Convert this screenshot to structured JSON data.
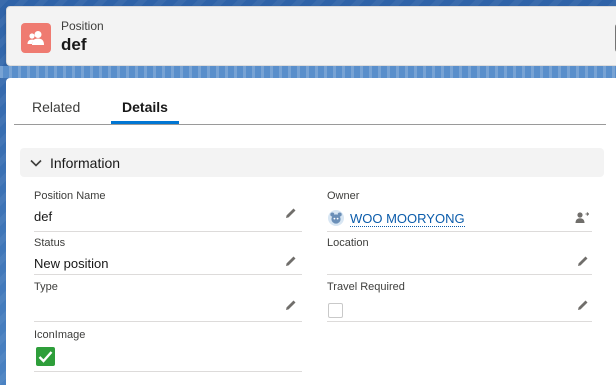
{
  "header": {
    "object_type": "Position",
    "record_name": "def",
    "icon": "position-icon"
  },
  "tabs": [
    {
      "label": "Related",
      "active": false
    },
    {
      "label": "Details",
      "active": true
    }
  ],
  "section": {
    "title": "Information",
    "icon": "chevron-down-icon"
  },
  "fields": {
    "position_name": {
      "label": "Position Name",
      "value": "def",
      "icon": "pencil-icon"
    },
    "owner": {
      "label": "Owner",
      "value": "WOO MOORYONG",
      "icon": "change-owner-icon",
      "avatar": "avatar-icon"
    },
    "status": {
      "label": "Status",
      "value": "New position",
      "icon": "pencil-icon"
    },
    "location": {
      "label": "Location",
      "value": "",
      "icon": "pencil-icon"
    },
    "type": {
      "label": "Type",
      "value": "",
      "icon": "pencil-icon"
    },
    "travel_required": {
      "label": "Travel Required",
      "checked": false,
      "icon": "pencil-icon"
    },
    "icon_image": {
      "label": "IconImage",
      "checked": true,
      "icon": "checkmark-icon"
    }
  },
  "colors": {
    "accent": "#0176d3",
    "object_icon": "#ef7b71",
    "link": "#0b5cab",
    "check_green": "#2e9e3a",
    "background_blue": "#3b6fae"
  }
}
